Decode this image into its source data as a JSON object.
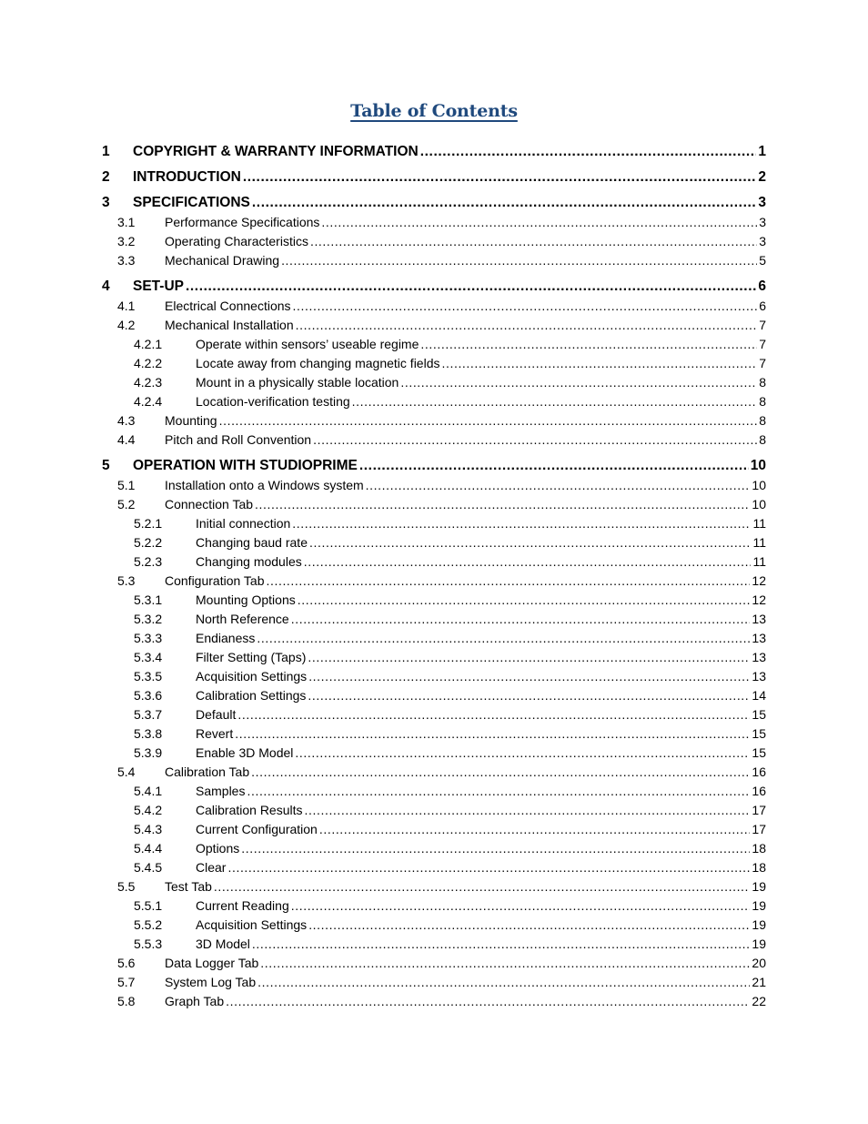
{
  "document": {
    "title": "Table of Contents",
    "title_color": "#1f497d"
  },
  "toc": [
    {
      "level": 1,
      "number": "1",
      "label": "COPYRIGHT & WARRANTY INFORMATION",
      "page": "1"
    },
    {
      "level": 1,
      "number": "2",
      "label": "INTRODUCTION",
      "page": "2"
    },
    {
      "level": 1,
      "number": "3",
      "label": "SPECIFICATIONS",
      "page": "3"
    },
    {
      "level": 2,
      "number": "3.1",
      "label": "Performance Specifications",
      "page": "3"
    },
    {
      "level": 2,
      "number": "3.2",
      "label": "Operating Characteristics",
      "page": "3"
    },
    {
      "level": 2,
      "number": "3.3",
      "label": "Mechanical Drawing",
      "page": "5"
    },
    {
      "level": 1,
      "number": "4",
      "label": "SET-UP",
      "page": "6"
    },
    {
      "level": 2,
      "number": "4.1",
      "label": "Electrical Connections",
      "page": "6"
    },
    {
      "level": 2,
      "number": "4.2",
      "label": "Mechanical Installation",
      "page": "7"
    },
    {
      "level": 3,
      "number": "4.2.1",
      "label": "Operate within sensors’ useable regime",
      "page": "7"
    },
    {
      "level": 3,
      "number": "4.2.2",
      "label": "Locate away from changing magnetic fields",
      "page": "7"
    },
    {
      "level": 3,
      "number": "4.2.3",
      "label": "Mount in a physically stable location",
      "page": "8"
    },
    {
      "level": 3,
      "number": "4.2.4",
      "label": "Location-verification testing",
      "page": "8"
    },
    {
      "level": 2,
      "number": "4.3",
      "label": "Mounting",
      "page": "8"
    },
    {
      "level": 2,
      "number": "4.4",
      "label": "Pitch and Roll Convention",
      "page": "8"
    },
    {
      "level": 1,
      "number": "5",
      "label": "OPERATION WITH STUDIOPRIME",
      "page": "10"
    },
    {
      "level": 2,
      "number": "5.1",
      "label": "Installation onto a Windows system",
      "page": "10"
    },
    {
      "level": 2,
      "number": "5.2",
      "label": "Connection Tab",
      "page": "10"
    },
    {
      "level": 3,
      "number": "5.2.1",
      "label": "Initial connection",
      "page": "11"
    },
    {
      "level": 3,
      "number": "5.2.2",
      "label": "Changing baud rate",
      "page": "11"
    },
    {
      "level": 3,
      "number": "5.2.3",
      "label": "Changing modules",
      "page": "11"
    },
    {
      "level": 2,
      "number": "5.3",
      "label": "Configuration Tab",
      "page": "12"
    },
    {
      "level": 3,
      "number": "5.3.1",
      "label": "Mounting Options",
      "page": "12"
    },
    {
      "level": 3,
      "number": "5.3.2",
      "label": "North Reference",
      "page": "13"
    },
    {
      "level": 3,
      "number": "5.3.3",
      "label": "Endianess",
      "page": "13"
    },
    {
      "level": 3,
      "number": "5.3.4",
      "label": "Filter Setting (Taps)",
      "page": "13"
    },
    {
      "level": 3,
      "number": "5.3.5",
      "label": "Acquisition Settings",
      "page": "13"
    },
    {
      "level": 3,
      "number": "5.3.6",
      "label": "Calibration Settings",
      "page": "14"
    },
    {
      "level": 3,
      "number": "5.3.7",
      "label": "Default",
      "page": "15"
    },
    {
      "level": 3,
      "number": "5.3.8",
      "label": "Revert",
      "page": "15"
    },
    {
      "level": 3,
      "number": "5.3.9",
      "label": "Enable 3D Model",
      "page": "15"
    },
    {
      "level": 2,
      "number": "5.4",
      "label": "Calibration Tab",
      "page": "16"
    },
    {
      "level": 3,
      "number": "5.4.1",
      "label": "Samples",
      "page": "16"
    },
    {
      "level": 3,
      "number": "5.4.2",
      "label": "Calibration Results",
      "page": "17"
    },
    {
      "level": 3,
      "number": "5.4.3",
      "label": "Current Configuration",
      "page": "17"
    },
    {
      "level": 3,
      "number": "5.4.4",
      "label": "Options",
      "page": "18"
    },
    {
      "level": 3,
      "number": "5.4.5",
      "label": "Clear",
      "page": "18"
    },
    {
      "level": 2,
      "number": "5.5",
      "label": "Test Tab",
      "page": "19"
    },
    {
      "level": 3,
      "number": "5.5.1",
      "label": "Current Reading",
      "page": "19"
    },
    {
      "level": 3,
      "number": "5.5.2",
      "label": "Acquisition Settings",
      "page": "19"
    },
    {
      "level": 3,
      "number": "5.5.3",
      "label": "3D Model",
      "page": "19"
    },
    {
      "level": 2,
      "number": "5.6",
      "label": "Data Logger Tab",
      "page": "20"
    },
    {
      "level": 2,
      "number": "5.7",
      "label": "System Log Tab",
      "page": "21"
    },
    {
      "level": 2,
      "number": "5.8",
      "label": "Graph Tab",
      "page": "22"
    }
  ]
}
